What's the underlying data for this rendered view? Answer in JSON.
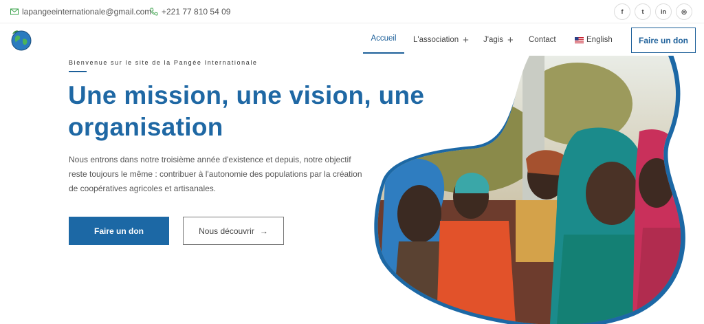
{
  "topbar": {
    "email": "lapangeeinternationale@gmail.com",
    "phone": "+221 77 810 54 09",
    "social": [
      {
        "icon": "facebook-icon",
        "glyph": "f"
      },
      {
        "icon": "twitter-icon",
        "glyph": "t"
      },
      {
        "icon": "linkedin-icon",
        "glyph": "in"
      },
      {
        "icon": "instagram-icon",
        "glyph": "◎"
      }
    ]
  },
  "nav": {
    "home": "Accueil",
    "association": "L'association",
    "agis": "J'agis",
    "contact": "Contact",
    "language": "English",
    "donate": "Faire un don"
  },
  "hero": {
    "eyebrow": "Bienvenue sur le site de la Pangée Internationale",
    "title": "Une mission, une vision, une organisation",
    "text": "Nous entrons dans notre troisième année d'existence et depuis, notre objectif reste toujours le même : contribuer à l'autonomie des populations par la création de coopératives agricoles et artisanales.",
    "primary_button": "Faire un don",
    "secondary_button": "Nous découvrir",
    "secondary_arrow": "→"
  },
  "colors": {
    "brand_blue": "#1c68a5",
    "title_blue": "#1f68a4"
  }
}
